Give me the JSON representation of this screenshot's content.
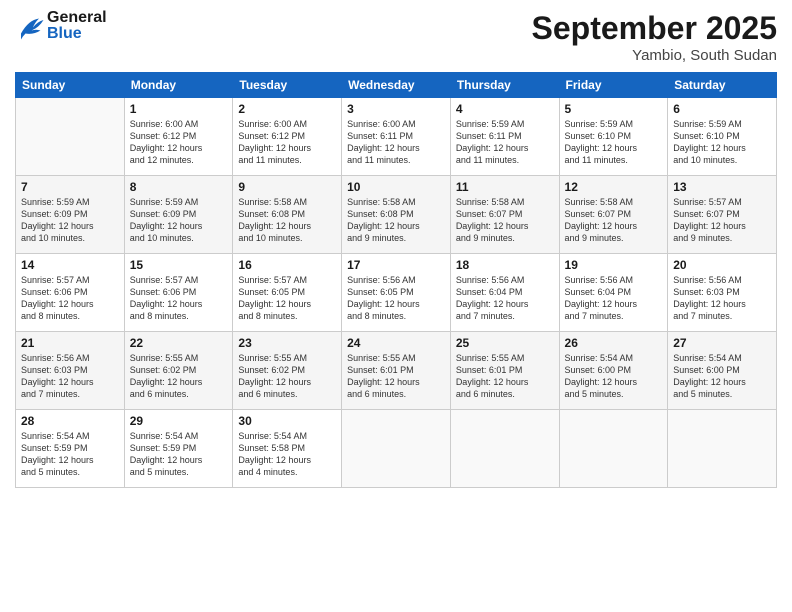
{
  "header": {
    "logo": {
      "line1": "General",
      "line2": "Blue"
    },
    "title": "September 2025",
    "location": "Yambio, South Sudan"
  },
  "weekdays": [
    "Sunday",
    "Monday",
    "Tuesday",
    "Wednesday",
    "Thursday",
    "Friday",
    "Saturday"
  ],
  "weeks": [
    [
      {
        "day": "",
        "info": ""
      },
      {
        "day": "1",
        "info": "Sunrise: 6:00 AM\nSunset: 6:12 PM\nDaylight: 12 hours\nand 12 minutes."
      },
      {
        "day": "2",
        "info": "Sunrise: 6:00 AM\nSunset: 6:12 PM\nDaylight: 12 hours\nand 11 minutes."
      },
      {
        "day": "3",
        "info": "Sunrise: 6:00 AM\nSunset: 6:11 PM\nDaylight: 12 hours\nand 11 minutes."
      },
      {
        "day": "4",
        "info": "Sunrise: 5:59 AM\nSunset: 6:11 PM\nDaylight: 12 hours\nand 11 minutes."
      },
      {
        "day": "5",
        "info": "Sunrise: 5:59 AM\nSunset: 6:10 PM\nDaylight: 12 hours\nand 11 minutes."
      },
      {
        "day": "6",
        "info": "Sunrise: 5:59 AM\nSunset: 6:10 PM\nDaylight: 12 hours\nand 10 minutes."
      }
    ],
    [
      {
        "day": "7",
        "info": "Sunrise: 5:59 AM\nSunset: 6:09 PM\nDaylight: 12 hours\nand 10 minutes."
      },
      {
        "day": "8",
        "info": "Sunrise: 5:59 AM\nSunset: 6:09 PM\nDaylight: 12 hours\nand 10 minutes."
      },
      {
        "day": "9",
        "info": "Sunrise: 5:58 AM\nSunset: 6:08 PM\nDaylight: 12 hours\nand 10 minutes."
      },
      {
        "day": "10",
        "info": "Sunrise: 5:58 AM\nSunset: 6:08 PM\nDaylight: 12 hours\nand 9 minutes."
      },
      {
        "day": "11",
        "info": "Sunrise: 5:58 AM\nSunset: 6:07 PM\nDaylight: 12 hours\nand 9 minutes."
      },
      {
        "day": "12",
        "info": "Sunrise: 5:58 AM\nSunset: 6:07 PM\nDaylight: 12 hours\nand 9 minutes."
      },
      {
        "day": "13",
        "info": "Sunrise: 5:57 AM\nSunset: 6:07 PM\nDaylight: 12 hours\nand 9 minutes."
      }
    ],
    [
      {
        "day": "14",
        "info": "Sunrise: 5:57 AM\nSunset: 6:06 PM\nDaylight: 12 hours\nand 8 minutes."
      },
      {
        "day": "15",
        "info": "Sunrise: 5:57 AM\nSunset: 6:06 PM\nDaylight: 12 hours\nand 8 minutes."
      },
      {
        "day": "16",
        "info": "Sunrise: 5:57 AM\nSunset: 6:05 PM\nDaylight: 12 hours\nand 8 minutes."
      },
      {
        "day": "17",
        "info": "Sunrise: 5:56 AM\nSunset: 6:05 PM\nDaylight: 12 hours\nand 8 minutes."
      },
      {
        "day": "18",
        "info": "Sunrise: 5:56 AM\nSunset: 6:04 PM\nDaylight: 12 hours\nand 7 minutes."
      },
      {
        "day": "19",
        "info": "Sunrise: 5:56 AM\nSunset: 6:04 PM\nDaylight: 12 hours\nand 7 minutes."
      },
      {
        "day": "20",
        "info": "Sunrise: 5:56 AM\nSunset: 6:03 PM\nDaylight: 12 hours\nand 7 minutes."
      }
    ],
    [
      {
        "day": "21",
        "info": "Sunrise: 5:56 AM\nSunset: 6:03 PM\nDaylight: 12 hours\nand 7 minutes."
      },
      {
        "day": "22",
        "info": "Sunrise: 5:55 AM\nSunset: 6:02 PM\nDaylight: 12 hours\nand 6 minutes."
      },
      {
        "day": "23",
        "info": "Sunrise: 5:55 AM\nSunset: 6:02 PM\nDaylight: 12 hours\nand 6 minutes."
      },
      {
        "day": "24",
        "info": "Sunrise: 5:55 AM\nSunset: 6:01 PM\nDaylight: 12 hours\nand 6 minutes."
      },
      {
        "day": "25",
        "info": "Sunrise: 5:55 AM\nSunset: 6:01 PM\nDaylight: 12 hours\nand 6 minutes."
      },
      {
        "day": "26",
        "info": "Sunrise: 5:54 AM\nSunset: 6:00 PM\nDaylight: 12 hours\nand 5 minutes."
      },
      {
        "day": "27",
        "info": "Sunrise: 5:54 AM\nSunset: 6:00 PM\nDaylight: 12 hours\nand 5 minutes."
      }
    ],
    [
      {
        "day": "28",
        "info": "Sunrise: 5:54 AM\nSunset: 5:59 PM\nDaylight: 12 hours\nand 5 minutes."
      },
      {
        "day": "29",
        "info": "Sunrise: 5:54 AM\nSunset: 5:59 PM\nDaylight: 12 hours\nand 5 minutes."
      },
      {
        "day": "30",
        "info": "Sunrise: 5:54 AM\nSunset: 5:58 PM\nDaylight: 12 hours\nand 4 minutes."
      },
      {
        "day": "",
        "info": ""
      },
      {
        "day": "",
        "info": ""
      },
      {
        "day": "",
        "info": ""
      },
      {
        "day": "",
        "info": ""
      }
    ]
  ]
}
